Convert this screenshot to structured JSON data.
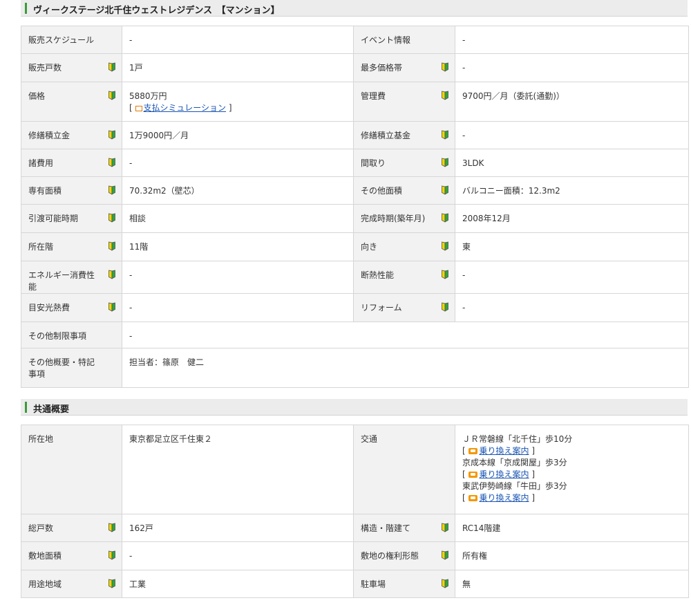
{
  "section1": {
    "title": "ヴィークステージ北千住ウェストレジデンス　【マンション】",
    "rows": [
      {
        "l1": "販売スケジュール",
        "v1": "-",
        "l2": "イベント情報",
        "v2": "-"
      },
      {
        "l1": "販売戸数",
        "v1": "1戸",
        "l2": "最多価格帯",
        "v2": "-"
      },
      {
        "l1": "価格",
        "v1": "5880万円",
        "l2": "管理費",
        "v2": "9700円／月（委託(通勤)）"
      },
      {
        "l1": "修繕積立金",
        "v1": "1万9000円／月",
        "l2": "修繕積立基金",
        "v2": "-"
      },
      {
        "l1": "諸費用",
        "v1": "-",
        "l2": "間取り",
        "v2": "3LDK"
      },
      {
        "l1": "専有面積",
        "v1": "70.32m2（壁芯）",
        "l2": "その他面積",
        "v2": "バルコニー面積：12.3m2"
      },
      {
        "l1": "引渡可能時期",
        "v1": "相談",
        "l2": "完成時期(築年月)",
        "v2": "2008年12月"
      },
      {
        "l1": "所在階",
        "v1": "11階",
        "l2": "向き",
        "v2": "東"
      },
      {
        "l1": "エネルギー消費性能",
        "v1": "-",
        "l2": "断熱性能",
        "v2": "-"
      },
      {
        "l1": "目安光熱費",
        "v1": "-",
        "l2": "リフォーム",
        "v2": "-"
      }
    ],
    "price_sim_link": "支払シミュレーション",
    "other_restrictions": {
      "label": "その他制限事項",
      "value": "-"
    },
    "other_notes": {
      "label": "その他概要・特記事項",
      "value": "担当者：篠原　健二"
    }
  },
  "section2": {
    "title": "共通概要",
    "address": {
      "label": "所在地",
      "value": "東京都足立区千住東２"
    },
    "transport": {
      "label": "交通",
      "lines": [
        "ＪＲ常磐線「北千住」歩10分",
        "京成本線「京成関屋」歩3分",
        "東武伊勢崎線「牛田」歩3分"
      ],
      "link": "乗り換え案内"
    },
    "rows": [
      {
        "l1": "総戸数",
        "v1": "162戸",
        "l2": "構造・階建て",
        "v2": "RC14階建"
      },
      {
        "l1": "敷地面積",
        "v1": "-",
        "l2": "敷地の権利形態",
        "v2": "所有権"
      },
      {
        "l1": "用途地域",
        "v1": "工業",
        "l2": "駐車場",
        "v2": "無"
      }
    ]
  },
  "icons": {
    "beginner_mark": "beginner-mark-icon",
    "pc": "pc-icon",
    "train": "train-icon"
  },
  "colors": {
    "accent": "#3c9a3c",
    "link": "#1a55b3",
    "label_bg": "#f2f2f2",
    "header_bg": "#ececec"
  }
}
